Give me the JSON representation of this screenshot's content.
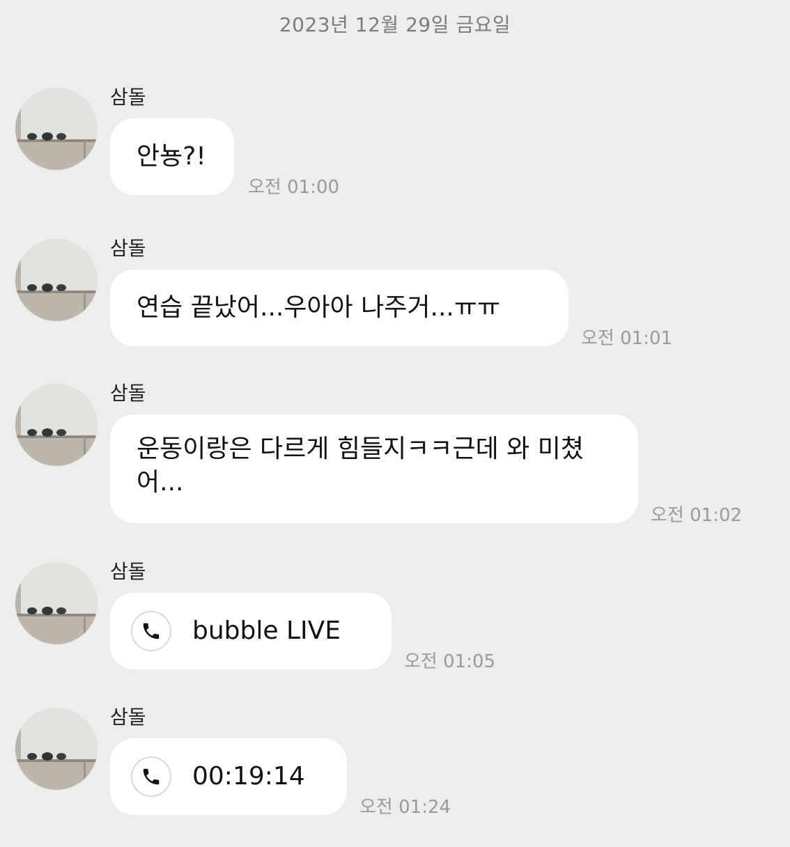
{
  "chat": {
    "date_header": "2023년 12월 29일 금요일",
    "messages": [
      {
        "sender": "삼돌",
        "text": "안뇽?!",
        "time": "오전 01:00",
        "type": "text"
      },
      {
        "sender": "삼돌",
        "text": "연습 끝났어...우아아 나주거...ㅠㅠ",
        "time": "오전 01:01",
        "type": "text"
      },
      {
        "sender": "삼돌",
        "text": "운동이랑은 다르게 힘들지ㅋㅋ근데 와 미쳤어...",
        "time": "오전 01:02",
        "type": "text"
      },
      {
        "sender": "삼돌",
        "text": "bubble LIVE",
        "time": "오전 01:05",
        "type": "call",
        "icon": "phone-icon"
      },
      {
        "sender": "삼돌",
        "text": "00:19:14",
        "time": "오전 01:24",
        "type": "call",
        "icon": "phone-icon"
      }
    ]
  },
  "colors": {
    "background": "#ededed",
    "bubble": "#ffffff",
    "date_text": "#7b7b7b",
    "time_text": "#9a9a9a"
  }
}
